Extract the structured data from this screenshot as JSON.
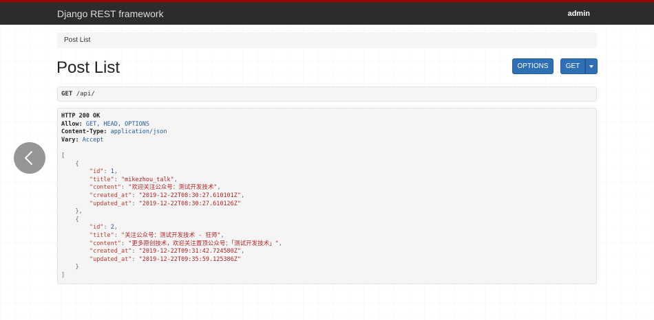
{
  "navbar": {
    "brand": "Django REST framework",
    "user": "admin"
  },
  "breadcrumb": {
    "item": "Post List"
  },
  "page": {
    "title": "Post List"
  },
  "actions": {
    "options_label": "OPTIONS",
    "get_label": "GET"
  },
  "request": {
    "method": "GET",
    "path": "/api/"
  },
  "response": {
    "status_line": "HTTP 200 OK",
    "headers": [
      {
        "key": "Allow:",
        "value": "GET, HEAD, OPTIONS"
      },
      {
        "key": "Content-Type:",
        "value": "application/json"
      },
      {
        "key": "Vary:",
        "value": "Accept"
      }
    ],
    "posts": [
      {
        "id": "1",
        "title": "\"mikezhou_talk\"",
        "content": "\"欢迎关注公众号：测试开发技术\"",
        "created_at": "\"2019-12-22T08:30:27.610101Z\"",
        "updated_at": "\"2019-12-22T08:30:27.610126Z\""
      },
      {
        "id": "2",
        "title": "\"关注公众号：测试开发技术 - 狂师\"",
        "content": "\"更多原创技术，欢迎关注置顶公众号：「测试开发技术」\"",
        "created_at": "\"2019-12-22T09:31:42.724580Z\"",
        "updated_at": "\"2019-12-22T09:35:59.125386Z\""
      }
    ]
  },
  "icons": {
    "back": "chevron-left-icon",
    "caret": "caret-down-icon"
  },
  "colors": {
    "navbar_bg": "#2c2c2c",
    "navbar_accent": "#a30000",
    "button_bg": "#2f6fb4"
  }
}
